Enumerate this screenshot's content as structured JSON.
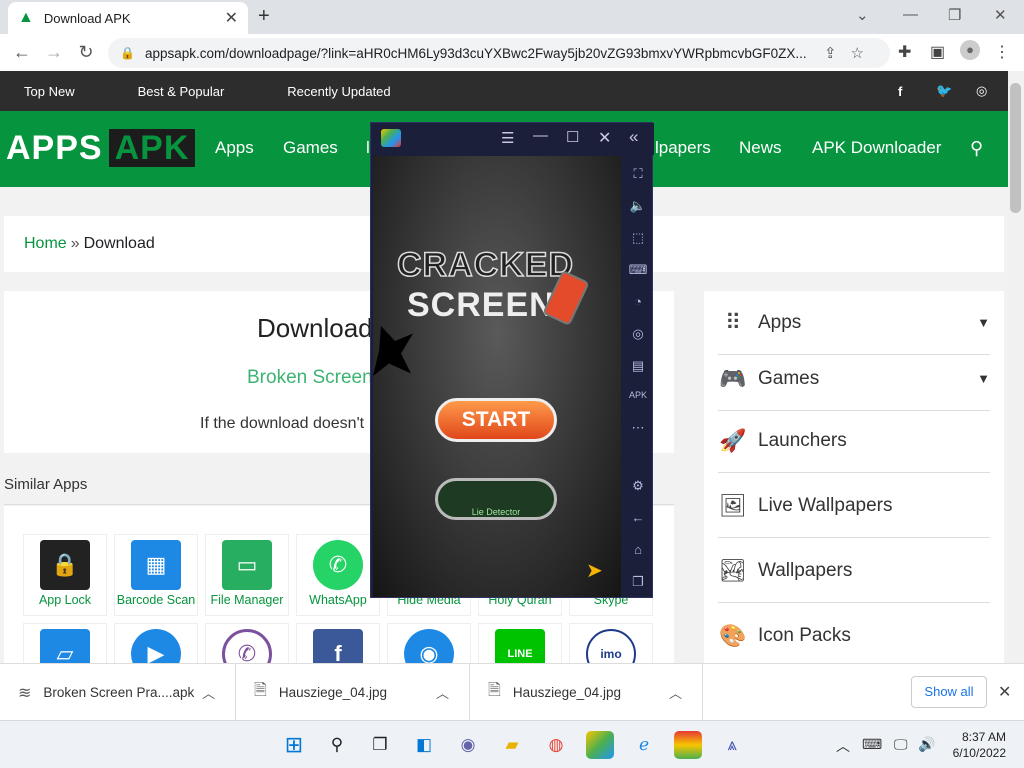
{
  "browser": {
    "tab_title": "Download APK",
    "url": "appsapk.com/downloadpage/?link=aHR0cHM6Ly93d3cuYXBwc2Fway5jb20vZG93bmxvYWRpbmcvbGF0ZX..."
  },
  "site": {
    "topbar": [
      "Top New",
      "Best & Popular",
      "Recently Updated"
    ],
    "logo_left": "APPS",
    "logo_right": "APK",
    "nav": [
      "Apps",
      "Games",
      "Wallpapers",
      "News",
      "APK Downloader"
    ],
    "nav_partial_left": "l",
    "nav_partial_right": "lpapers",
    "breadcrumb": {
      "home": "Home",
      "sep": "»",
      "current": "Download"
    },
    "download": {
      "heading": "Download",
      "app_name": "Broken Screen",
      "note": "If the download doesn't"
    },
    "similar_heading": "Similar Apps",
    "similar_apps": [
      {
        "label": "App Lock",
        "color": "#222"
      },
      {
        "label": "Barcode Scan",
        "color": "#1e88e5"
      },
      {
        "label": "File Manager",
        "color": "#27ae60"
      },
      {
        "label": "WhatsApp",
        "color": "#25d366"
      },
      {
        "label": "Hide Media",
        "color": "#777"
      },
      {
        "label": "Holy Quran",
        "color": "#777"
      },
      {
        "label": "Skype",
        "color": "#777"
      }
    ],
    "similar_row2_colors": [
      "#1e88e5",
      "#1e88e5",
      "#7b519d",
      "#3b5998",
      "#1e88e5",
      "#00c300",
      "#1e3a8a"
    ],
    "sidebar": [
      {
        "label": "Apps",
        "icon": "grid-icon",
        "glyph": "⠿",
        "caret": "˅"
      },
      {
        "label": "Games",
        "icon": "gamepad-icon",
        "glyph": "🎮",
        "caret": "˅"
      },
      {
        "label": "Launchers",
        "icon": "rocket-icon",
        "glyph": "🚀",
        "caret": ""
      },
      {
        "label": "Live Wallpapers",
        "icon": "images-icon",
        "glyph": "🖼",
        "caret": ""
      },
      {
        "label": "Wallpapers",
        "icon": "image-icon",
        "glyph": "🏞",
        "caret": ""
      },
      {
        "label": "Icon Packs",
        "icon": "palette-icon",
        "glyph": "🎨",
        "caret": ""
      }
    ]
  },
  "emulator": {
    "game_title_1": "CRACKED",
    "game_title_2": "SCREEN",
    "start_label": "START",
    "lie_label": "Lie Detector"
  },
  "downloads": [
    {
      "name": "Broken Screen Pra....apk"
    },
    {
      "name": "Hausziege_04.jpg"
    },
    {
      "name": "Hausziege_04.jpg"
    }
  ],
  "downloads_show_all": "Show all",
  "clock": {
    "time": "8:37 AM",
    "date": "6/10/2022"
  },
  "colors": {
    "brand_green": "#06943e",
    "dark_bar": "#2d2d2d"
  }
}
